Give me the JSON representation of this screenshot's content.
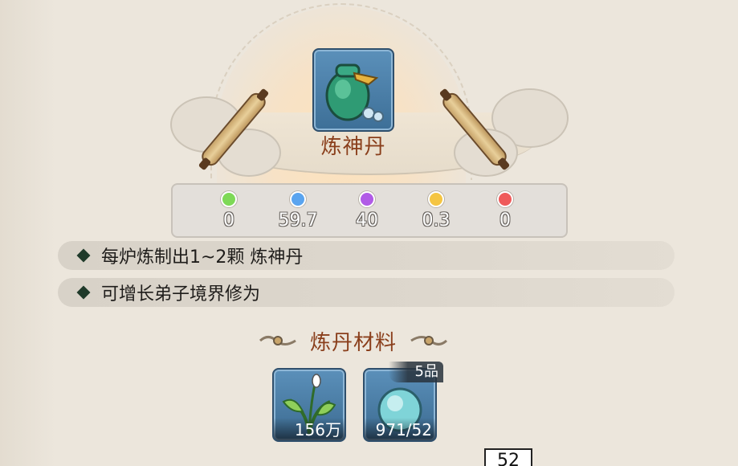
{
  "item": {
    "name": "炼神丹",
    "icon": "medicine-pouch-icon"
  },
  "stats": [
    {
      "color": "#7ed957",
      "value": "0"
    },
    {
      "color": "#5aa4ef",
      "value": "59.7"
    },
    {
      "color": "#b15be6",
      "value": "40"
    },
    {
      "color": "#f5c542",
      "value": "0.3"
    },
    {
      "color": "#ef5a5a",
      "value": "0"
    }
  ],
  "descriptions": [
    "每炉炼制出1~2颗 炼神丹",
    "可增长弟子境界修为"
  ],
  "materials_section": {
    "title": "炼丹材料"
  },
  "materials": [
    {
      "icon": "herb-plant-icon",
      "count": "156万"
    },
    {
      "icon": "spirit-orb-icon",
      "count": "971/52",
      "grade": "5品"
    }
  ],
  "quantity": "52",
  "colors": {
    "title": "#8a3f1c",
    "item_frame": "#4a7ea8",
    "background": "#ece6dc"
  }
}
